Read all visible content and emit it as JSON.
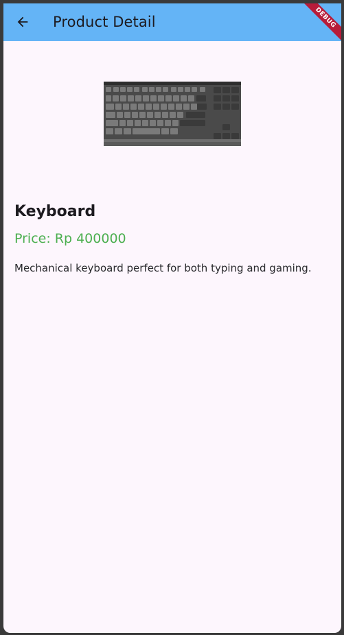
{
  "appbar": {
    "title": "Product Detail",
    "back_icon": "arrow-back-icon",
    "color": "#64b4f6"
  },
  "debug_banner": {
    "label": "DEBUG",
    "color": "#b71c3a"
  },
  "product": {
    "image_icon": "keyboard-image",
    "name": "Keyboard",
    "price": "Price: Rp 400000",
    "price_color": "#4caf50",
    "description": "Mechanical keyboard perfect for both typing and gaming."
  },
  "colors": {
    "background": "#fdf6fd"
  }
}
